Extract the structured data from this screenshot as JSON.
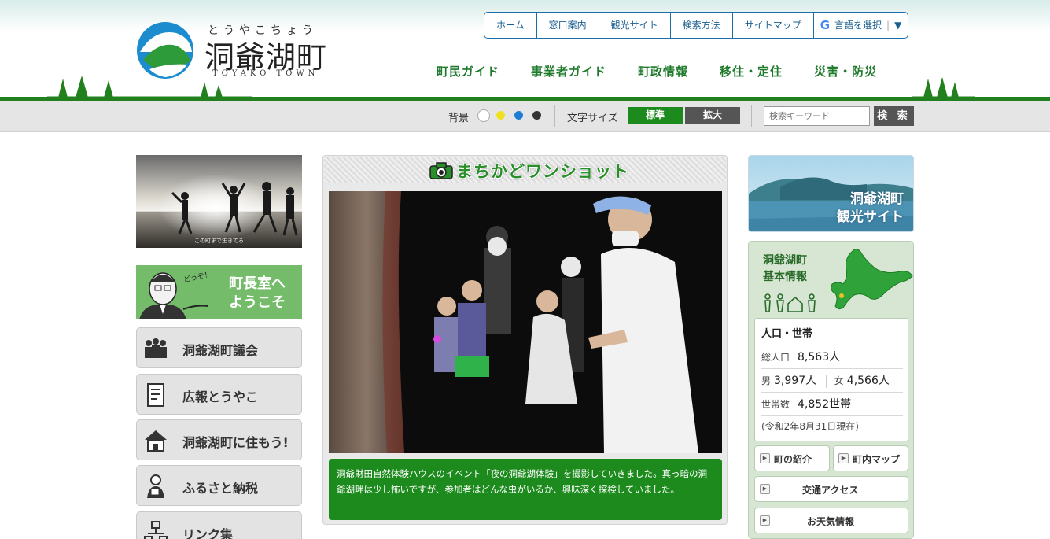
{
  "header": {
    "logo_kana": "とうやこちょう",
    "logo_name": "洞爺湖町",
    "logo_en": "TOYAKO TOWN",
    "util_nav": [
      "ホーム",
      "窓口案内",
      "観光サイト",
      "検索方法",
      "サイトマップ"
    ],
    "language_select": "言語を選択",
    "language_arrow": "▼",
    "google_glyph": "G",
    "main_nav": [
      "町民ガイド",
      "事業者ガイド",
      "町政情報",
      "移住・定住",
      "災害・防災"
    ]
  },
  "toolbar": {
    "background_label": "背景",
    "background_colors": [
      "#ffffff",
      "#f0e020",
      "#1e7ed6",
      "#333333"
    ],
    "font_size_label": "文字サイズ",
    "font_size_standard": "標準",
    "font_size_large": "拡大",
    "search_placeholder": "検索キーワード",
    "search_button": "検 索"
  },
  "left": {
    "photo_caption": "この町まで生きてる",
    "mayor_banner_line1": "町長室へ",
    "mayor_banner_line2": "ようこそ",
    "mayor_note": "どうぞ！",
    "menu": [
      "洞爺湖町議会",
      "広報とうやこ",
      "洞爺湖町に住もう!",
      "ふるさと納税",
      "リンク集"
    ]
  },
  "center": {
    "title": "まちかどワンショット",
    "caption": "洞爺財田自然体験ハウスのイベント「夜の洞爺湖体験」を撮影していきました。真っ暗の洞爺湖畔は少し怖いですが、参加者はどんな虫がいるか、興味深く探検していました。"
  },
  "right": {
    "kanko_line1": "洞爺湖町",
    "kanko_line2": "観光サイト",
    "info_title_line1": "洞爺湖町",
    "info_title_line2": "基本情報",
    "stats": {
      "heading": "人口・世帯",
      "total_label": "総人口",
      "total_value": "8,563人",
      "male_label": "男",
      "male_value": "3,997人",
      "female_label": "女",
      "female_value": "4,566人",
      "households_label": "世帯数",
      "households_value": "4,852世帯",
      "as_of": "(令和2年8月31日現在)"
    },
    "buttons": {
      "intro": "町の紹介",
      "map": "町内マップ",
      "access": "交通アクセス",
      "weather": "お天気情報"
    }
  },
  "colors": {
    "brand_green": "#23801f",
    "nav_blue": "#1a6fa8",
    "caption_green": "#1c8a1c"
  }
}
